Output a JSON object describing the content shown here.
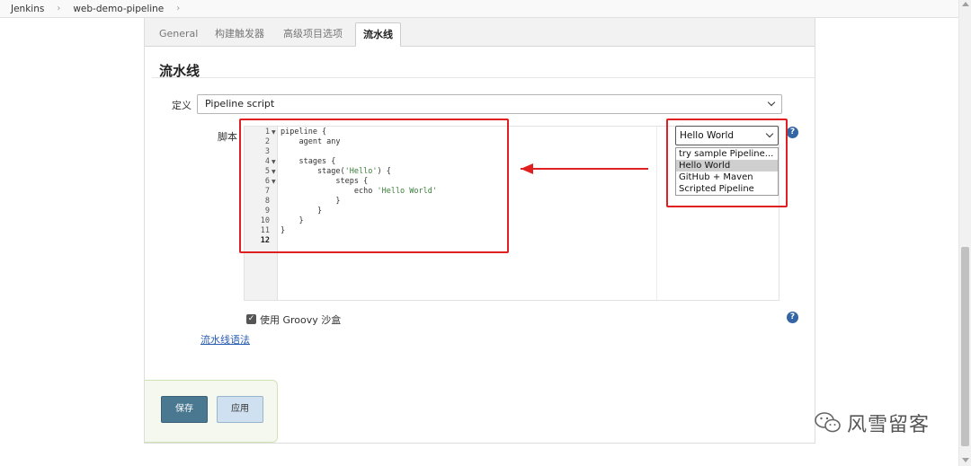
{
  "breadcrumb": {
    "items": [
      "Jenkins",
      "web-demo-pipeline"
    ],
    "separator": "›"
  },
  "tabs": [
    {
      "label": "General",
      "active": false
    },
    {
      "label": "构建触发器",
      "active": false
    },
    {
      "label": "高级项目选项",
      "active": false
    },
    {
      "label": "流水线",
      "active": true
    }
  ],
  "section": {
    "title": "流水线"
  },
  "definition": {
    "label": "定义",
    "value": "Pipeline script"
  },
  "script": {
    "label": "脚本",
    "line_numbers": [
      "1",
      "2",
      "3",
      "4",
      "5",
      "6",
      "7",
      "8",
      "9",
      "10",
      "11",
      "12"
    ],
    "code": [
      {
        "text": "pipeline {",
        "fold": true
      },
      {
        "text": "    agent any",
        "fold": false
      },
      {
        "text": "",
        "fold": false
      },
      {
        "text": "    stages {",
        "fold": true
      },
      {
        "text": "        stage('Hello') {",
        "fold": true
      },
      {
        "text": "            steps {",
        "fold": true
      },
      {
        "text": "                echo 'Hello World'",
        "fold": false
      },
      {
        "text": "            }",
        "fold": false
      },
      {
        "text": "        }",
        "fold": false
      },
      {
        "text": "    }",
        "fold": false
      },
      {
        "text": "}",
        "fold": false
      },
      {
        "text": "",
        "fold": false
      }
    ]
  },
  "sample": {
    "selected": "Hello World",
    "options": [
      "try sample Pipeline...",
      "Hello World",
      "GitHub + Maven",
      "Scripted Pipeline"
    ]
  },
  "sandbox": {
    "label": "使用 Groovy 沙盒",
    "checked": true
  },
  "syntax_link": "流水线语法",
  "buttons": {
    "save": "保存",
    "apply": "应用"
  },
  "watermark": "风雪留客",
  "colors": {
    "annotation_red": "#e02020",
    "save_button": "#4a7891",
    "apply_button": "#cfe0f0",
    "help_icon": "#3465a4"
  }
}
